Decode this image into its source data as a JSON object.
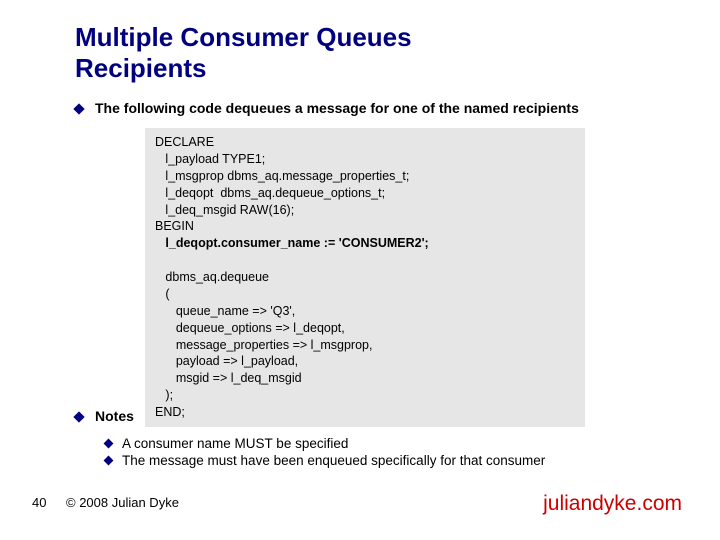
{
  "title_line1": "Multiple Consumer Queues",
  "title_line2": "Recipients",
  "bullet_main": "The following code dequeues a message for one of the named recipients",
  "code": {
    "l1": "DECLARE",
    "l2": "   l_payload TYPE1;",
    "l3": "   l_msgprop dbms_aq.message_properties_t;",
    "l4": "   l_deqopt  dbms_aq.dequeue_options_t;",
    "l5": "   l_deq_msgid RAW(16);",
    "l6": "BEGIN",
    "l7": "   l_deqopt.consumer_name := 'CONSUMER2';",
    "l8": "",
    "l9": "   dbms_aq.dequeue",
    "l10": "   (",
    "l11": "      queue_name => 'Q3',",
    "l12": "      dequeue_options => l_deqopt,",
    "l13": "      message_properties => l_msgprop,",
    "l14": "      payload => l_payload,",
    "l15": "      msgid => l_deq_msgid",
    "l16": "   );",
    "l17": "END;"
  },
  "notes_label": "Notes",
  "note1": "A consumer name MUST be specified",
  "note2": "The message must have been enqueued specifically for that consumer",
  "page_number": "40",
  "copyright": "© 2008 Julian Dyke",
  "domain": "juliandyke.com"
}
